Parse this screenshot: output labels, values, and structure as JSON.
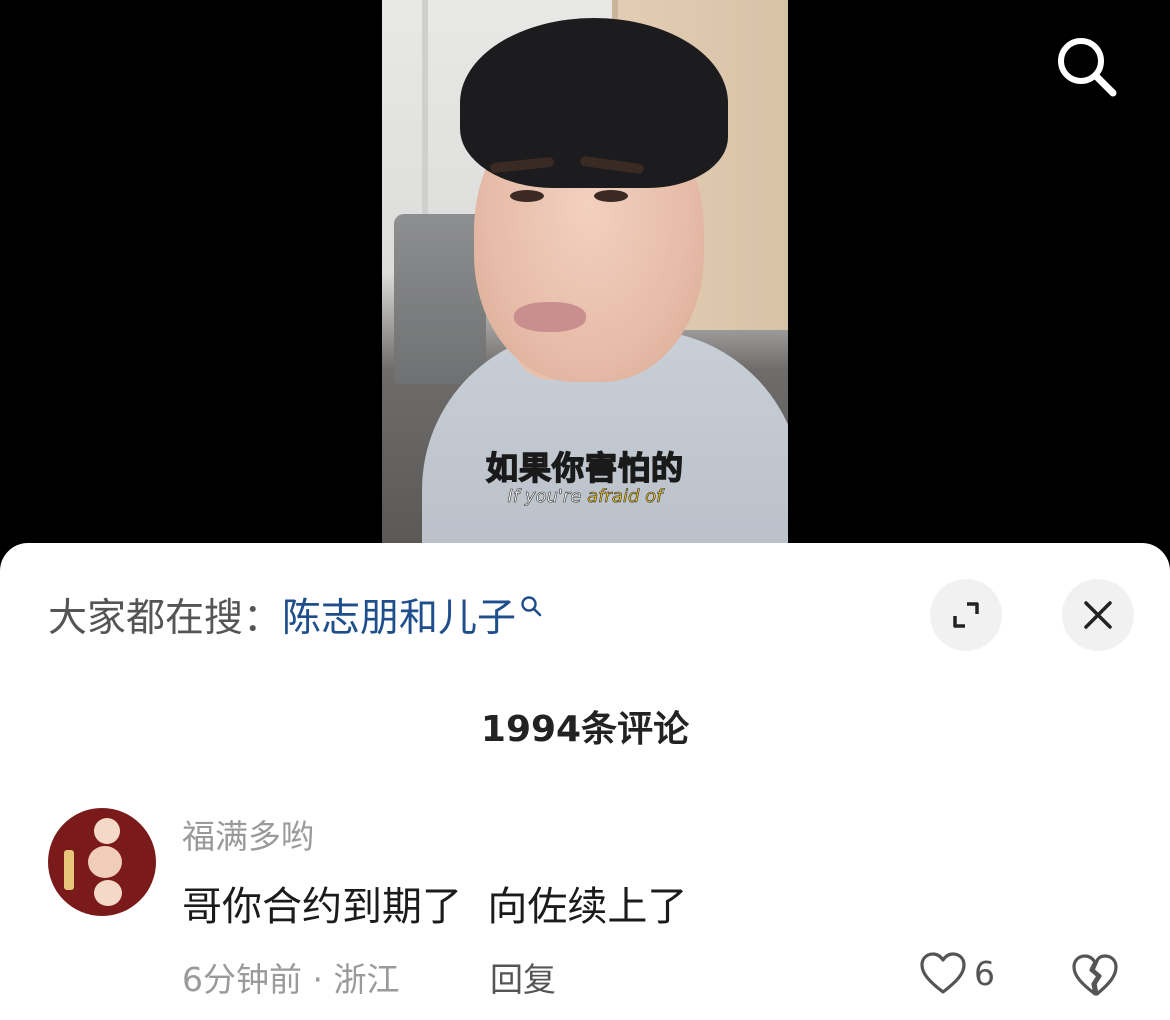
{
  "video": {
    "subtitle_cn_prefix": "如果你",
    "subtitle_cn_highlight": "害怕的",
    "subtitle_en_prefix": "If you're ",
    "subtitle_en_highlight": "afraid of"
  },
  "search_icon": "search-icon",
  "sheet": {
    "suggest_prefix": "大家都在搜：",
    "suggest_query": "陈志朋和儿子",
    "suggest_icon": "search-small-icon",
    "expand_icon": "expand-icon",
    "close_icon": "close-icon",
    "comment_count": "1994条评论"
  },
  "comments": [
    {
      "username": "福满多哟",
      "text": "哥你合约到期了  向佐续上了",
      "time_location": "6分钟前 · 浙江",
      "reply_label": "回复",
      "likes": "6"
    }
  ],
  "colors": {
    "link_blue": "#1f4e8c",
    "subtitle_highlight": "#f2c21a",
    "muted_gray": "#9a9a9a"
  }
}
